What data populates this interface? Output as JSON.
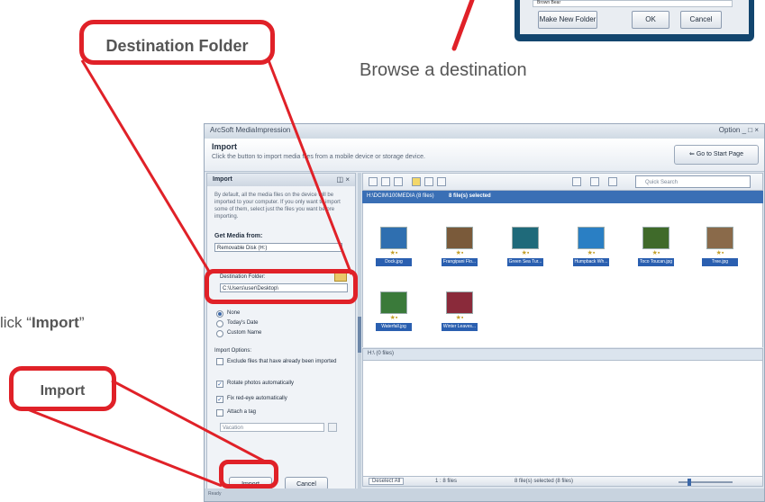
{
  "top_dialog": {
    "row_label": "Brown Bear",
    "make_folder_label": "Make New Folder",
    "ok_label": "OK",
    "cancel_label": "Cancel"
  },
  "callouts": {
    "destination_folder": "Destination Folder",
    "browse": "Browse a destination",
    "click_prefix": "lick “",
    "click_bold": "Import",
    "click_suffix": "”",
    "import": "Import"
  },
  "app": {
    "title": "ArcSoft MediaImpression",
    "window_buttons": "Option _ □ ×",
    "header_title": "Import",
    "header_desc": "Click the button to import media files from a mobile device or storage device.",
    "start_page_label": "⇐ Go to Start Page"
  },
  "left_panel": {
    "title": "Import",
    "close": "◫ ×",
    "description": "By default, all the media files on the device will be imported to your computer. If you only want to import some of them, select just the files you want before importing.",
    "get_media_label": "Get Media from:",
    "get_media_value": "Removable Disk (H:)",
    "dest_label": "Destination Folder:",
    "dest_value": "C:\\Users\\user\\Desktop\\",
    "radios": [
      "None",
      "Today's Date",
      "Custom Name"
    ],
    "options_title": "Import Options:",
    "checks": [
      {
        "label": "Exclude files that have already been imported",
        "checked": false
      },
      {
        "label": "Rotate photos automatically",
        "checked": true
      },
      {
        "label": "Fix red-eye automatically",
        "checked": true
      },
      {
        "label": "Attach a tag",
        "checked": false
      }
    ],
    "tag_placeholder": "Vacation",
    "import_btn": "Import",
    "cancel_btn": "Cancel"
  },
  "toolbar": {
    "search_placeholder": "Quick Search"
  },
  "groups": {
    "group1_label": "H:\\DCIM\\100MEDIA (8 files)",
    "group1_selected": "8 file(s) selected",
    "group2_label": "H:\\ (0 files)"
  },
  "thumbnails": [
    {
      "caption": "Dock.jpg",
      "color": "#2f6fb0"
    },
    {
      "caption": "Frangipani Flo...",
      "color": "#7a5a3a"
    },
    {
      "caption": "Green Sea Tur...",
      "color": "#1f6a7a"
    },
    {
      "caption": "Humpback Wh...",
      "color": "#2a7fc4"
    },
    {
      "caption": "Toco Toucan.jpg",
      "color": "#3f6a2a"
    },
    {
      "caption": "Tree.jpg",
      "color": "#8a6a4a"
    },
    {
      "caption": "Waterfall.jpg",
      "color": "#3a7a3a"
    },
    {
      "caption": "Winter Leaves...",
      "color": "#8a2a3a"
    }
  ],
  "status": {
    "deselect": "Deselect All",
    "count": "1 : 8 files",
    "selected": "8 file(s) selected (8 files)"
  },
  "bottom_strip_text": "Ready"
}
